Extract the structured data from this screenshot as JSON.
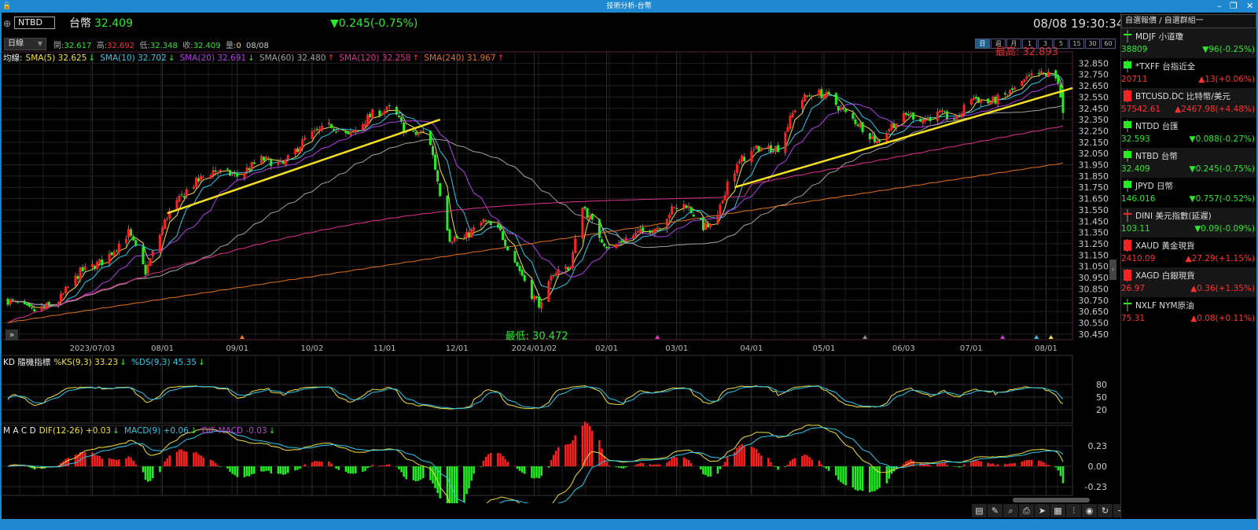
{
  "window": {
    "title": "技術分析-台幣",
    "controls": [
      "–",
      "❐",
      "✕"
    ]
  },
  "header": {
    "symbol": "NTBD",
    "name": "台幣",
    "price": "32.409",
    "change": "▼0.245(-0.75%)",
    "datetime": "08/08 19:30:34"
  },
  "period_select": "日線",
  "ohlc": {
    "open_label": "開:",
    "open": "32.617",
    "high_label": "高:",
    "high": "32.692",
    "low_label": "低:",
    "low": "32.348",
    "close_label": "收:",
    "close": "32.409",
    "vol_label": "量:",
    "vol": "0",
    "date": "08/08"
  },
  "period_tabs": [
    {
      "label": "日",
      "active": true
    },
    {
      "label": "週"
    },
    {
      "label": "月"
    },
    {
      "label": "1"
    },
    {
      "label": "3"
    },
    {
      "label": "5"
    },
    {
      "label": "15"
    },
    {
      "label": "30"
    },
    {
      "label": "60"
    }
  ],
  "legend": {
    "prefix": "均線:",
    "items": [
      {
        "text": "SMA(5) 32.625",
        "arrow": "↓",
        "color": "#f0e040",
        "arrow_color": "#2ee82e"
      },
      {
        "text": "SMA(10) 32.702",
        "arrow": "↓",
        "color": "#30c8e8",
        "arrow_color": "#2ee82e"
      },
      {
        "text": "SMA(20) 32.691",
        "arrow": "↓",
        "color": "#b040e8",
        "arrow_color": "#2ee82e"
      },
      {
        "text": "SMA(60) 32.480",
        "arrow": "↑",
        "color": "#a0a0a0",
        "arrow_color": "#ff3030"
      },
      {
        "text": "SMA(120) 32.258",
        "arrow": "↑",
        "color": "#e03090",
        "arrow_color": "#ff3030"
      },
      {
        "text": "SMA(240) 31.967",
        "arrow": "↑",
        "color": "#e07020",
        "arrow_color": "#ff3030"
      }
    ]
  },
  "kd_legend": {
    "title": "KD 隨機指標",
    "items": [
      {
        "text": "%KS(9,3) 33.23",
        "arrow": "↓",
        "color": "#f0e040"
      },
      {
        "text": "%DS(9,3) 45.35",
        "arrow": "↓",
        "color": "#30c8e8"
      }
    ]
  },
  "macd_legend": {
    "title": "M A C D",
    "items": [
      {
        "text": "DIF(12-26) +0.03",
        "arrow": "↓",
        "color": "#f0e040"
      },
      {
        "text": "MACD(9) +0.06",
        "arrow": "↓",
        "color": "#30c8e8"
      },
      {
        "text": "DIF-MACD -0.03",
        "arrow": "↓",
        "color": "#c040e0"
      }
    ]
  },
  "chart_data": {
    "type": "candlestick",
    "price_ylim": [
      30.4,
      32.95
    ],
    "price_ticks": [
      "32.850",
      "32.750",
      "32.650",
      "32.550",
      "32.450",
      "32.350",
      "32.250",
      "32.150",
      "32.050",
      "31.950",
      "31.850",
      "31.750",
      "31.650",
      "31.550",
      "31.450",
      "31.350",
      "31.250",
      "31.150",
      "31.050",
      "30.950",
      "30.850",
      "30.750",
      "30.650",
      "30.550",
      "30.450"
    ],
    "date_range": [
      "2023/05/29",
      "2024/08/08"
    ],
    "date_ticks": [
      "2023/07/03",
      "08/01",
      "09/01",
      "10/02",
      "11/01",
      "12/01",
      "2024/01/02",
      "02/01",
      "03/01",
      "04/01",
      "05/01",
      "06/03",
      "07/01",
      "08/01"
    ],
    "date_tick_values": [
      "2023-07-03",
      "2023-08-01",
      "2023-09-01",
      "2023-10-02",
      "2023-11-01",
      "2023-12-01",
      "2024-01-02",
      "2024-02-01",
      "2024-03-01",
      "2024-04-01",
      "2024-05-01",
      "2024-06-03",
      "2024-07-01",
      "2024-08-01"
    ],
    "close_path": [
      [
        "2023-05-29",
        30.75
      ],
      [
        "2023-06-08",
        30.65
      ],
      [
        "2023-06-18",
        30.72
      ],
      [
        "2023-06-28",
        31.0
      ],
      [
        "2023-07-08",
        31.1
      ],
      [
        "2023-07-18",
        31.35
      ],
      [
        "2023-07-25",
        31.0
      ],
      [
        "2023-08-03",
        31.5
      ],
      [
        "2023-08-12",
        31.75
      ],
      [
        "2023-08-22",
        31.9
      ],
      [
        "2023-09-01",
        31.85
      ],
      [
        "2023-09-11",
        32.0
      ],
      [
        "2023-09-20",
        31.95
      ],
      [
        "2023-09-30",
        32.2
      ],
      [
        "2023-10-10",
        32.3
      ],
      [
        "2023-10-17",
        32.2
      ],
      [
        "2023-10-27",
        32.4
      ],
      [
        "2023-11-04",
        32.45
      ],
      [
        "2023-11-11",
        32.2
      ],
      [
        "2023-11-19",
        32.25
      ],
      [
        "2023-11-24",
        31.7
      ],
      [
        "2023-11-28",
        31.3
      ],
      [
        "2023-12-04",
        31.3
      ],
      [
        "2023-12-12",
        31.45
      ],
      [
        "2023-12-19",
        31.35
      ],
      [
        "2023-12-25",
        31.1
      ],
      [
        "2024-01-01",
        30.8
      ],
      [
        "2024-01-05",
        30.7
      ],
      [
        "2024-01-10",
        31.0
      ],
      [
        "2024-01-17",
        31.05
      ],
      [
        "2024-01-22",
        31.6
      ],
      [
        "2024-01-28",
        31.35
      ],
      [
        "2024-02-02",
        31.2
      ],
      [
        "2024-02-09",
        31.3
      ],
      [
        "2024-02-15",
        31.35
      ],
      [
        "2024-02-22",
        31.4
      ],
      [
        "2024-02-28",
        31.55
      ],
      [
        "2024-03-05",
        31.6
      ],
      [
        "2024-03-12",
        31.4
      ],
      [
        "2024-03-17",
        31.4
      ],
      [
        "2024-03-22",
        31.8
      ],
      [
        "2024-03-28",
        32.0
      ],
      [
        "2024-04-04",
        32.1
      ],
      [
        "2024-04-12",
        32.1
      ],
      [
        "2024-04-20",
        32.5
      ],
      [
        "2024-04-27",
        32.6
      ],
      [
        "2024-05-03",
        32.55
      ],
      [
        "2024-05-10",
        32.4
      ],
      [
        "2024-05-16",
        32.3
      ],
      [
        "2024-05-23",
        32.15
      ],
      [
        "2024-05-29",
        32.3
      ],
      [
        "2024-06-05",
        32.4
      ],
      [
        "2024-06-11",
        32.35
      ],
      [
        "2024-06-18",
        32.4
      ],
      [
        "2024-06-25",
        32.35
      ],
      [
        "2024-07-01",
        32.55
      ],
      [
        "2024-07-08",
        32.5
      ],
      [
        "2024-07-14",
        32.55
      ],
      [
        "2024-07-21",
        32.65
      ],
      [
        "2024-07-27",
        32.75
      ],
      [
        "2024-08-03",
        32.75
      ],
      [
        "2024-08-06",
        32.7
      ],
      [
        "2024-08-08",
        32.41
      ]
    ],
    "trendlines": [
      {
        "from": [
          "2023-08-03",
          31.52
        ],
        "to": [
          "2023-11-24",
          32.35
        ],
        "color": "#f5e020"
      },
      {
        "from": [
          "2024-03-25",
          31.75
        ],
        "to": [
          "2024-08-12",
          32.63
        ],
        "color": "#f5e020"
      }
    ],
    "annotations": {
      "high": "最高: 32.893",
      "high_value": 32.893,
      "high_date": "2024-07-24",
      "low": "最低: 30.472",
      "low_value": 30.472,
      "low_date": "2024-01-03"
    },
    "markers": [
      {
        "date": "2023-09-03",
        "color": "#ff7a20"
      },
      {
        "date": "2024-02-22",
        "color": "#ff30c0"
      },
      {
        "date": "2024-05-18",
        "color": "#909090"
      },
      {
        "date": "2024-07-14",
        "color": "#c040e0"
      },
      {
        "date": "2024-07-28",
        "color": "#30c8e8"
      },
      {
        "date": "2024-08-03",
        "color": "#f0e040"
      }
    ],
    "kd_ticks": [
      "80",
      "50",
      "20"
    ],
    "macd_ticks": [
      "0.23",
      "0.00",
      "-0.23"
    ],
    "up_color": "#ff2020",
    "down_color": "#20f020"
  },
  "watchlist": {
    "title": "自選報價 / 自選群組一",
    "items": [
      {
        "name": "MDJF 小道瓊",
        "price": "38809",
        "change": "▼96(-0.25%)",
        "dir": "dn",
        "candle": "cross-green"
      },
      {
        "name": "*TXFF 台指近全",
        "price": "20711",
        "change": "▲13(+0.06%)",
        "dir": "up",
        "candle": "green"
      },
      {
        "name": "BTCUSD.DC 比特幣/美元",
        "price": "57542.61",
        "change": "▲2467.98(+4.48%)",
        "dir": "up",
        "candle": "red"
      },
      {
        "name": "NTDD 台匯",
        "price": "32.593",
        "change": "▼0.088(-0.27%)",
        "dir": "dn",
        "candle": "green"
      },
      {
        "name": "NTBD 台幣",
        "price": "32.409",
        "change": "▼0.245(-0.75%)",
        "dir": "dn",
        "candle": "green"
      },
      {
        "name": "JPYD 日幣",
        "price": "146.016",
        "change": "▼0.757(-0.52%)",
        "dir": "dn",
        "candle": "green"
      },
      {
        "name": "DINI 美元指數(延遲)",
        "price": "103.11",
        "change": "▼0.09(-0.09%)",
        "dir": "dn",
        "candle": "cross-red"
      },
      {
        "name": "XAUD 黃金現貨",
        "price": "2410.09",
        "change": "▲27.29(+1.15%)",
        "dir": "up",
        "candle": "red"
      },
      {
        "name": "XAGD 白銀現貨",
        "price": "26.97",
        "change": "▲0.36(+1.35%)",
        "dir": "up",
        "candle": "red"
      },
      {
        "name": "NXLF NYM原油",
        "price": "75.31",
        "change": "▲0.08(+0.11%)",
        "dir": "up",
        "candle": "cross-green"
      }
    ]
  },
  "toolbar": [
    {
      "icon": "document-icon",
      "glyph": "▤"
    },
    {
      "icon": "draw-line-icon",
      "glyph": "✎"
    },
    {
      "icon": "zoom-table-icon",
      "glyph": "⌕"
    },
    {
      "icon": "print-icon",
      "glyph": "⎙"
    },
    {
      "icon": "cursor-icon",
      "glyph": "➤"
    },
    {
      "icon": "layout-icon",
      "glyph": "▦"
    },
    {
      "icon": "indicator-icon",
      "glyph": "⫶"
    },
    {
      "icon": "eye-icon",
      "glyph": "◉"
    },
    {
      "icon": "refresh-icon",
      "glyph": "↻"
    },
    {
      "icon": "zoom-out-icon",
      "glyph": "−"
    },
    {
      "icon": "zoom-in-icon",
      "glyph": "+"
    }
  ]
}
